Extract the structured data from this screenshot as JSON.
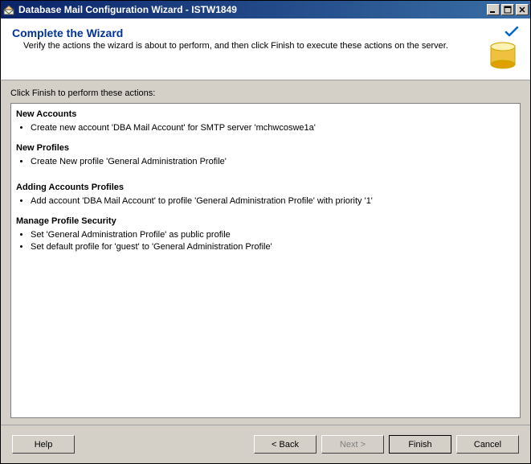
{
  "window": {
    "title": "Database Mail Configuration Wizard - ISTW1849"
  },
  "header": {
    "title": "Complete the Wizard",
    "subtitle": "Verify the actions the wizard is about to perform, and then click Finish to execute these actions on the server."
  },
  "instruction": "Click Finish to perform these actions:",
  "sections": {
    "new_accounts": {
      "title": "New Accounts",
      "item0": "Create new account 'DBA Mail Account' for SMTP server 'mchwcoswe1a'"
    },
    "new_profiles": {
      "title": "New Profiles",
      "item0": "Create New profile 'General Administration Profile'"
    },
    "adding_accounts_profiles": {
      "title": "Adding Accounts Profiles",
      "item0": "Add account 'DBA Mail Account' to profile 'General Administration Profile' with priority '1'"
    },
    "manage_profile_security": {
      "title": "Manage Profile Security",
      "item0": "Set 'General Administration Profile' as public profile",
      "item1": "Set default profile for 'guest' to 'General Administration Profile'"
    }
  },
  "buttons": {
    "help": "Help",
    "back": "< Back",
    "next": "Next >",
    "finish": "Finish",
    "cancel": "Cancel"
  }
}
